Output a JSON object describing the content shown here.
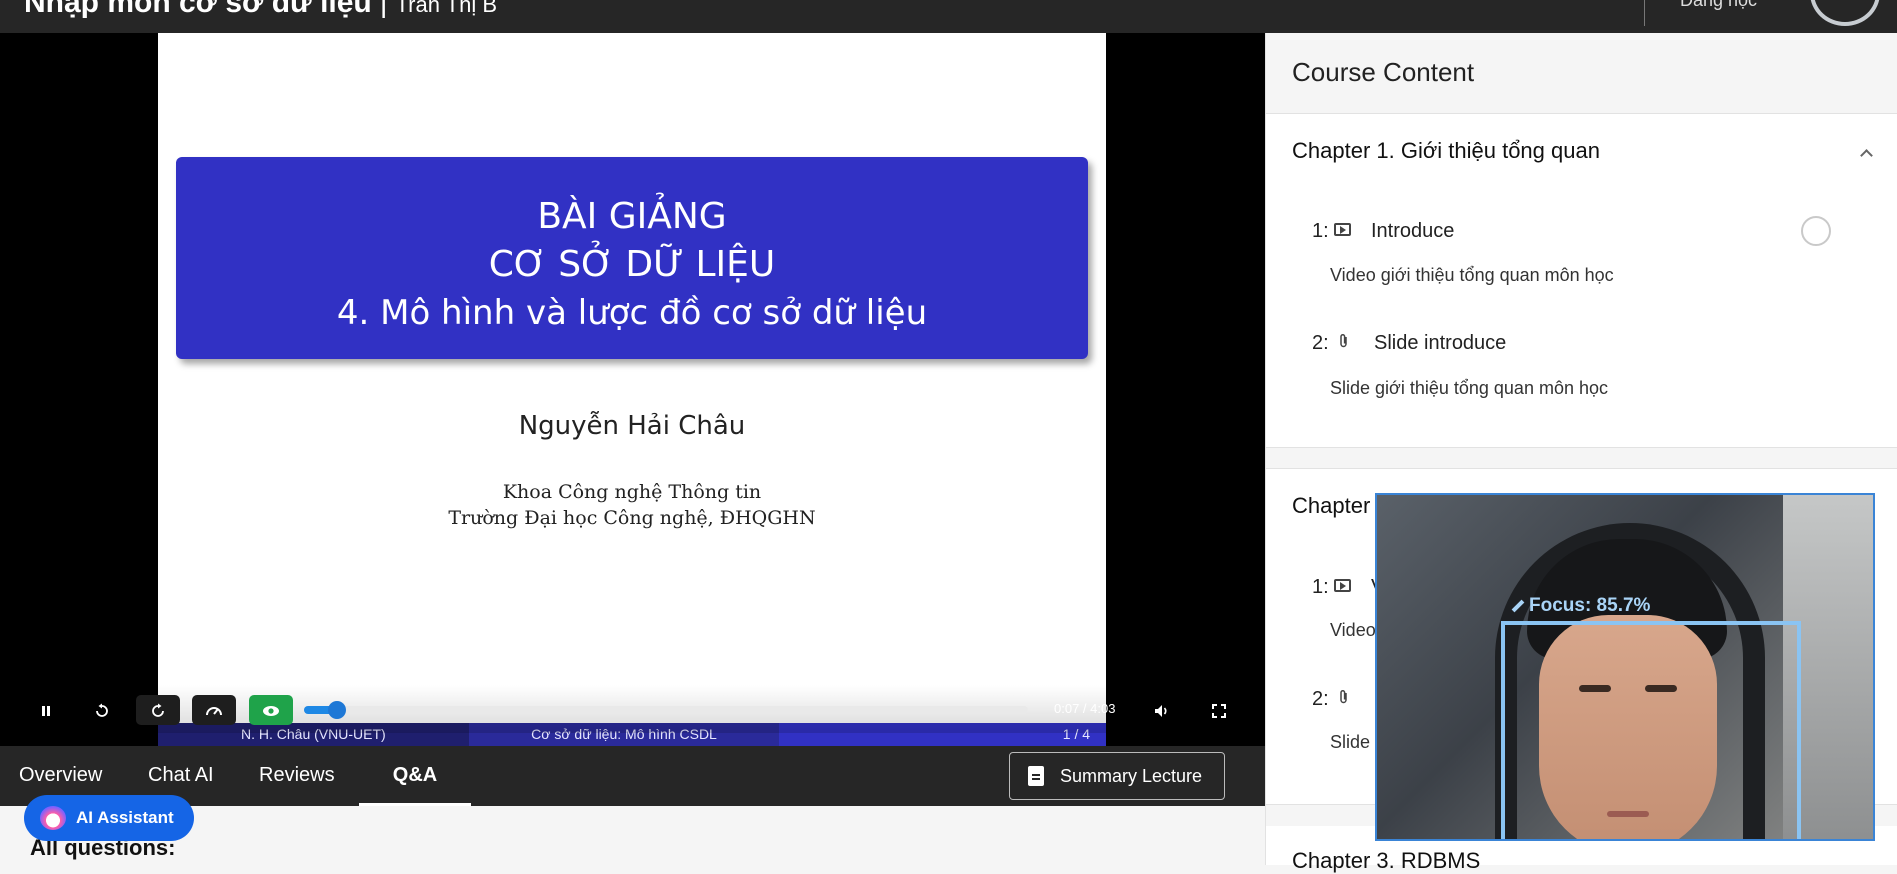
{
  "header": {
    "course_title": "Nhập môn cơ sở dữ liệu",
    "separator": "|",
    "teacher": "Trần Thị B",
    "user_text": "Đang học"
  },
  "slide": {
    "banner_line1": "BÀI GIẢNG",
    "banner_line2": "CƠ SỞ DỮ LIỆU",
    "banner_line3": "4. Mô hình và lược đồ cơ sở dữ liệu",
    "author": "Nguyễn Hải Châu",
    "institution_line1": "Khoa Công nghệ Thông tin",
    "institution_line2": "Trường Đại học Công nghệ, ĐHQGHN",
    "footer_left": "N. H. Châu  (VNU-UET)",
    "footer_center": "Cơ sở dữ liệu: Mô hình CSDL",
    "footer_right": "1 / 4"
  },
  "player": {
    "current_time": "0:07",
    "duration": "4:03",
    "time_display": "0:07 / 4:03",
    "progress_fraction": 0.045,
    "icons": {
      "pause": "pause-icon",
      "rewind": "rewind-10-icon",
      "forward": "forward-10-icon",
      "speed": "speedometer-icon",
      "focus": "eye-icon",
      "volume": "volume-icon",
      "fullscreen": "fullscreen-icon"
    }
  },
  "tabs": [
    {
      "label": "Overview",
      "active": false
    },
    {
      "label": "Chat AI",
      "active": false
    },
    {
      "label": "Reviews",
      "active": false
    },
    {
      "label": "Q&A",
      "active": true
    }
  ],
  "summary_button": "Summary Lecture",
  "ai_assistant": "AI Assistant",
  "questions_heading": "All questions:",
  "course_content": {
    "title": "Course Content",
    "chapters": [
      {
        "title": "Chapter 1. Giới thiệu tổng quan",
        "lessons": [
          {
            "num": "1:",
            "title": "Introduce",
            "desc": "Video giới thiệu tổng quan môn học",
            "type": "video"
          },
          {
            "num": "2:",
            "title": "Slide introduce",
            "desc": "Slide giới thiệu tổng quan môn học",
            "type": "attachment"
          }
        ]
      },
      {
        "title": "Chapter",
        "lessons": [
          {
            "num": "1:",
            "title": "V",
            "desc": "Video",
            "type": "video"
          },
          {
            "num": "2:",
            "title": "",
            "desc": "Slide",
            "type": "attachment"
          }
        ]
      },
      {
        "title": "Chapter 3. RDBMS",
        "lessons": []
      }
    ]
  },
  "webcam": {
    "focus_label": "Focus: 85.7%",
    "focus_value": 85.7,
    "border_color": "#3a84d6"
  },
  "colors": {
    "accent": "#1565e6",
    "slide_banner": "#3131c4",
    "focus_green": "#1fa34a",
    "header_bg": "#262626"
  }
}
